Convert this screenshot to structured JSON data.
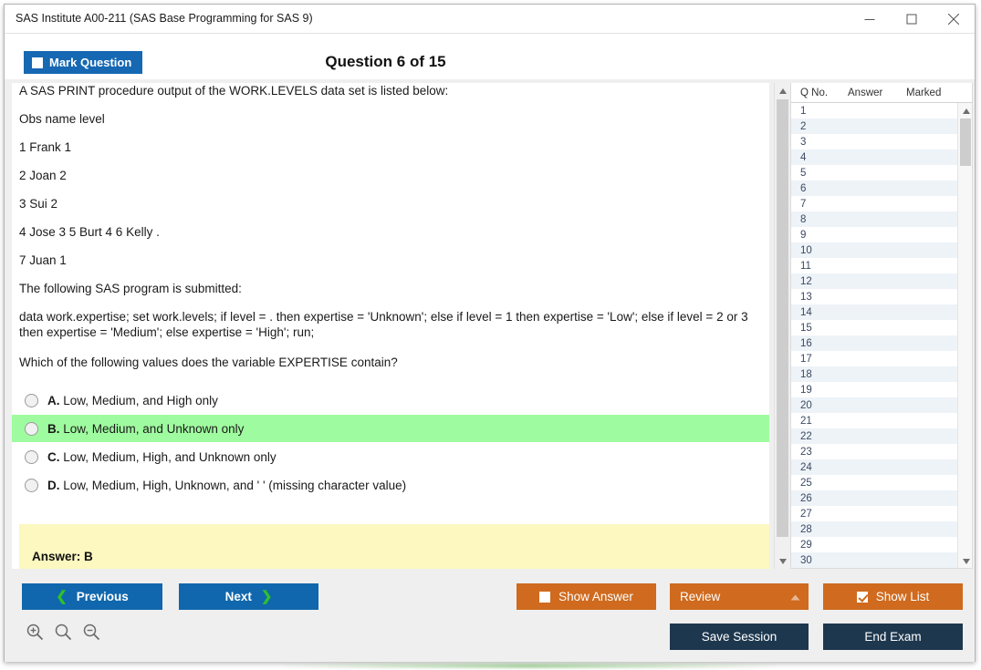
{
  "window": {
    "title": "SAS Institute A00-211 (SAS Base Programming for SAS 9)",
    "minimize_icon": "minimize-icon",
    "maximize_icon": "maximize-icon",
    "close_icon": "close-icon"
  },
  "header": {
    "mark_question_label": "Mark Question",
    "question_counter": "Question 6 of 15"
  },
  "question": {
    "lines": [
      "A SAS PRINT procedure output of the WORK.LEVELS data set is listed below:",
      "Obs name level",
      "1 Frank 1",
      "2 Joan 2",
      "3 Sui 2",
      "4 Jose 3 5 Burt 4 6 Kelly .",
      "7 Juan 1",
      "The following SAS program is submitted:"
    ],
    "code": "data work.expertise; set work.levels; if level = . then expertise = 'Unknown'; else if level = 1 then expertise = 'Low'; else if level = 2 or 3 then expertise = 'Medium'; else expertise = 'High'; run;",
    "prompt": "Which of the following values does the variable EXPERTISE contain?",
    "options": [
      {
        "letter": "A.",
        "text": "Low, Medium, and High only",
        "correct": false
      },
      {
        "letter": "B.",
        "text": "Low, Medium, and Unknown only",
        "correct": true
      },
      {
        "letter": "C.",
        "text": "Low, Medium, High, and Unknown only",
        "correct": false
      },
      {
        "letter": "D.",
        "text": "Low, Medium, High, Unknown, and ' ' (missing character value)",
        "correct": false
      }
    ],
    "answer_label": "Answer: B"
  },
  "question_list": {
    "columns": [
      "Q No.",
      "Answer",
      "Marked"
    ],
    "rows": [
      {
        "qno": "1",
        "answer": "",
        "marked": ""
      },
      {
        "qno": "2",
        "answer": "",
        "marked": ""
      },
      {
        "qno": "3",
        "answer": "",
        "marked": ""
      },
      {
        "qno": "4",
        "answer": "",
        "marked": ""
      },
      {
        "qno": "5",
        "answer": "",
        "marked": ""
      },
      {
        "qno": "6",
        "answer": "",
        "marked": ""
      },
      {
        "qno": "7",
        "answer": "",
        "marked": ""
      },
      {
        "qno": "8",
        "answer": "",
        "marked": ""
      },
      {
        "qno": "9",
        "answer": "",
        "marked": ""
      },
      {
        "qno": "10",
        "answer": "",
        "marked": ""
      },
      {
        "qno": "11",
        "answer": "",
        "marked": ""
      },
      {
        "qno": "12",
        "answer": "",
        "marked": ""
      },
      {
        "qno": "13",
        "answer": "",
        "marked": ""
      },
      {
        "qno": "14",
        "answer": "",
        "marked": ""
      },
      {
        "qno": "15",
        "answer": "",
        "marked": ""
      },
      {
        "qno": "16",
        "answer": "",
        "marked": ""
      },
      {
        "qno": "17",
        "answer": "",
        "marked": ""
      },
      {
        "qno": "18",
        "answer": "",
        "marked": ""
      },
      {
        "qno": "19",
        "answer": "",
        "marked": ""
      },
      {
        "qno": "20",
        "answer": "",
        "marked": ""
      },
      {
        "qno": "21",
        "answer": "",
        "marked": ""
      },
      {
        "qno": "22",
        "answer": "",
        "marked": ""
      },
      {
        "qno": "23",
        "answer": "",
        "marked": ""
      },
      {
        "qno": "24",
        "answer": "",
        "marked": ""
      },
      {
        "qno": "25",
        "answer": "",
        "marked": ""
      },
      {
        "qno": "26",
        "answer": "",
        "marked": ""
      },
      {
        "qno": "27",
        "answer": "",
        "marked": ""
      },
      {
        "qno": "28",
        "answer": "",
        "marked": ""
      },
      {
        "qno": "29",
        "answer": "",
        "marked": ""
      },
      {
        "qno": "30",
        "answer": "",
        "marked": ""
      }
    ]
  },
  "footer": {
    "previous_label": "Previous",
    "next_label": "Next",
    "show_answer_label": "Show Answer",
    "review_label": "Review",
    "show_list_label": "Show List",
    "save_session_label": "Save Session",
    "end_exam_label": "End Exam",
    "zoom_in_icon": "zoom-in-icon",
    "zoom_reset_icon": "zoom-reset-icon",
    "zoom_out_icon": "zoom-out-icon"
  },
  "colors": {
    "accent_blue": "#1067ad",
    "accent_orange": "#cf6a1e",
    "dark_navy": "#1d374e",
    "correct_green": "#9ffb9f",
    "answer_yellow": "#fcf8c0",
    "chevron_green": "#2fbf2f"
  }
}
